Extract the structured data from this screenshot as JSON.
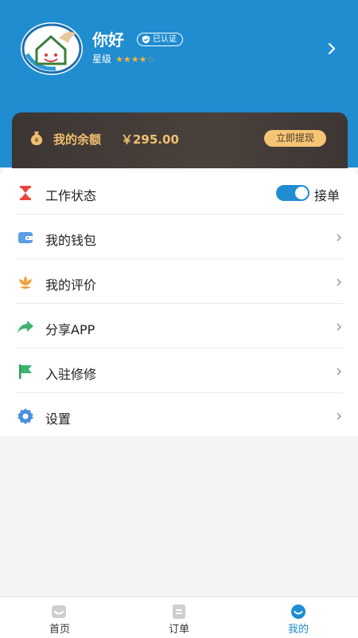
{
  "profile": {
    "name": "你好",
    "verified_label": "已认证",
    "rating_label": "星级",
    "stars_filled": 4,
    "stars_total": 5
  },
  "balance": {
    "label": "我的余额",
    "amount": "￥295.00",
    "withdraw_label": "立即提现"
  },
  "menu": {
    "items": [
      {
        "label": "工作状态",
        "icon": "hourglass-icon",
        "toggle_label": "接单",
        "toggle_on": true
      },
      {
        "label": "我的钱包",
        "icon": "wallet-icon"
      },
      {
        "label": "我的评价",
        "icon": "lotus-icon"
      },
      {
        "label": "分享APP",
        "icon": "share-icon"
      },
      {
        "label": "入驻修修",
        "icon": "flag-icon"
      },
      {
        "label": "设置",
        "icon": "gear-icon"
      }
    ]
  },
  "tabbar": {
    "tabs": [
      {
        "label": "首页",
        "icon": "home-icon"
      },
      {
        "label": "订单",
        "icon": "order-icon"
      },
      {
        "label": "我的",
        "icon": "profile-icon",
        "active": true
      }
    ]
  },
  "colors": {
    "primary": "#1f8dd0",
    "balance_text": "#f0c070",
    "withdraw_button": "#f7c476"
  }
}
